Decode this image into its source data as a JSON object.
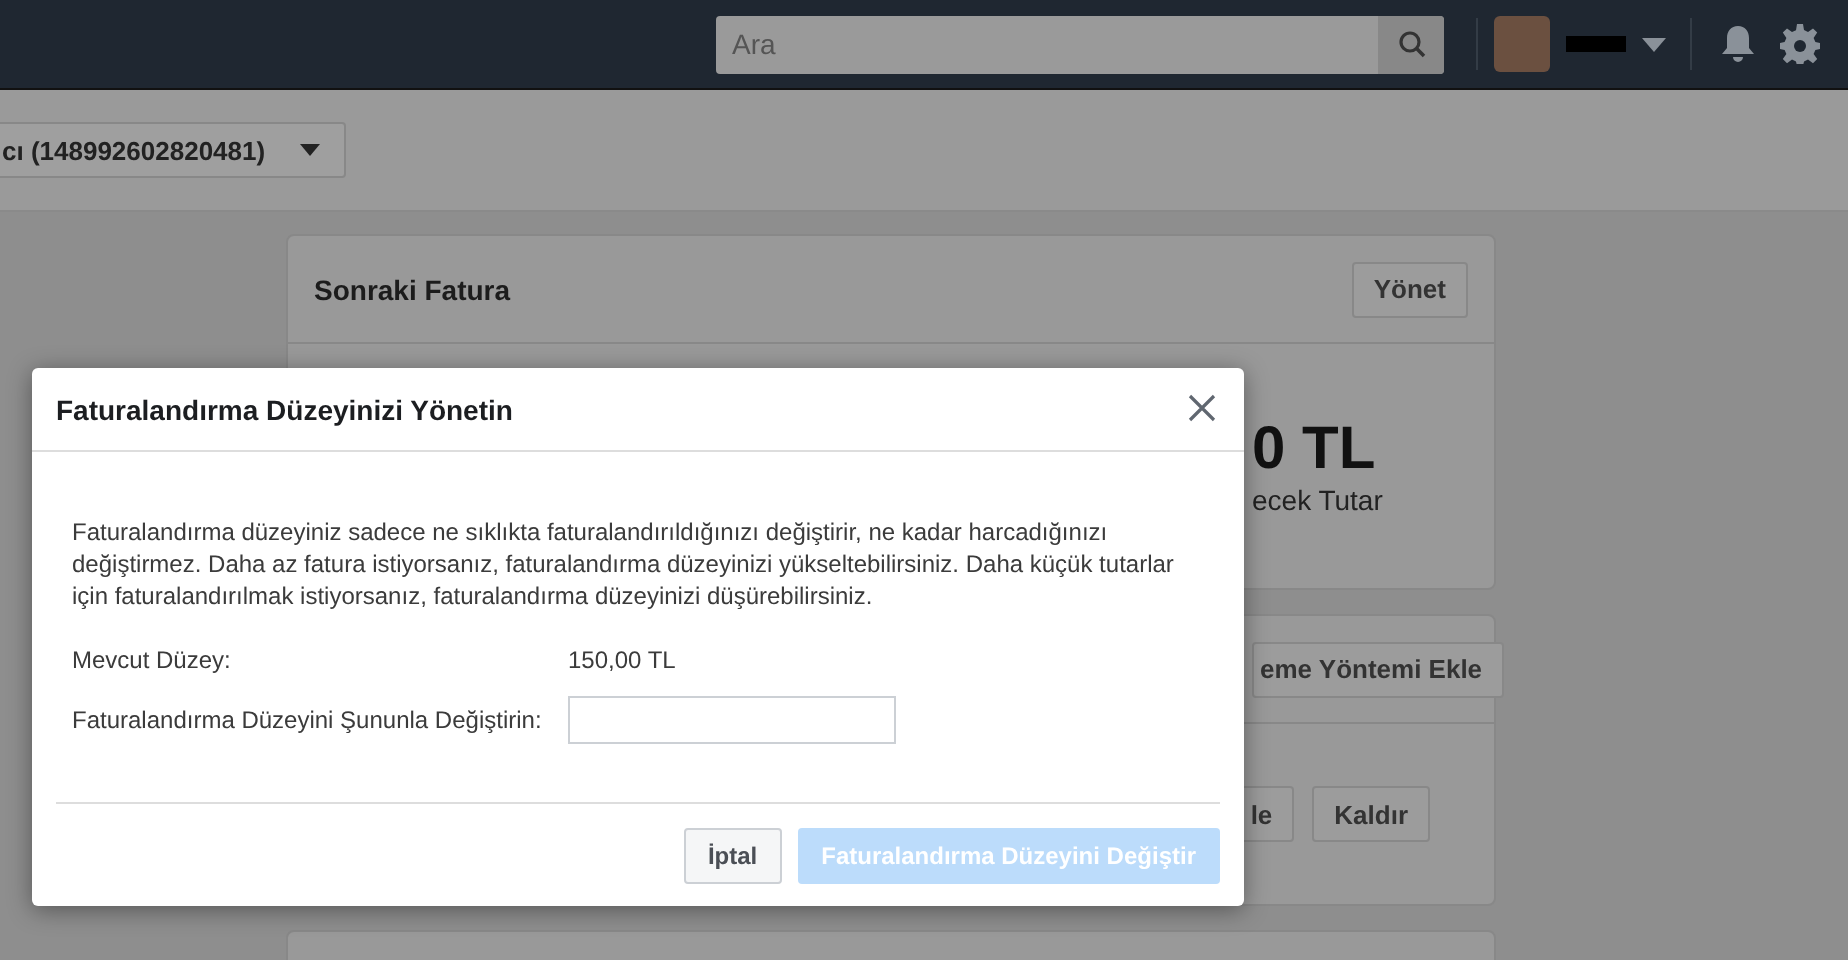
{
  "topbar": {
    "search": {
      "placeholder": "Ara"
    }
  },
  "account_selector": {
    "label": "cı (148992602820481)"
  },
  "cards": [
    {
      "title": "Sonraki Fatura",
      "header_button": "Yönet",
      "amount": "0 TL",
      "amount_caption": "ecek Tutar"
    },
    {
      "header_button": "eme Yöntemi Ekle",
      "buttons": [
        "le",
        "Kaldır"
      ]
    }
  ],
  "dialog": {
    "title": "Faturalandırma Düzeyinizi Yönetin",
    "description": "Faturalandırma düzeyiniz sadece ne sıklıkta faturalandırıldığınızı değiştirir, ne kadar harcadığınızı değiştirmez. Daha az fatura istiyorsanız, faturalandırma düzeyinizi yükseltebilirsiniz. Daha küçük tutarlar için faturalandırılmak istiyorsanız, faturalandırma düzeyinizi düşürebilirsiniz.",
    "current_label": "Mevcut Düzey:",
    "current_value": "150,00 TL",
    "change_label": "Faturalandırma Düzeyini Şununla Değiştirin:",
    "cancel_button": "İptal",
    "submit_button": {
      "label": "Faturalandırma Düzeyini Değiştir",
      "disabled": true
    }
  }
}
